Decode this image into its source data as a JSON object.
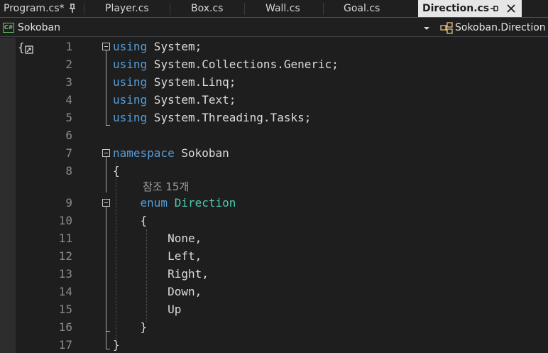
{
  "tabs": [
    {
      "label": "Program.cs*",
      "pinned": true,
      "active": false
    },
    {
      "label": "Player.cs",
      "active": false
    },
    {
      "label": "Box.cs",
      "active": false
    },
    {
      "label": "Wall.cs",
      "active": false
    },
    {
      "label": "Goal.cs",
      "active": false
    },
    {
      "label": "Direction.cs",
      "pinned": true,
      "active": true
    }
  ],
  "navbar": {
    "project_badge": "C#",
    "project": "Sokoban",
    "member": "Sokoban.Direction"
  },
  "editor": {
    "language": "csharp",
    "lines": [
      {
        "n": "1",
        "tokens": [
          [
            "kw",
            "using"
          ],
          [
            "pl",
            " System;"
          ]
        ]
      },
      {
        "n": "2",
        "tokens": [
          [
            "kw",
            "using"
          ],
          [
            "pl",
            " System.Collections.Generic;"
          ]
        ]
      },
      {
        "n": "3",
        "tokens": [
          [
            "kw",
            "using"
          ],
          [
            "pl",
            " System.Linq;"
          ]
        ]
      },
      {
        "n": "4",
        "tokens": [
          [
            "kw",
            "using"
          ],
          [
            "pl",
            " System.Text;"
          ]
        ]
      },
      {
        "n": "5",
        "tokens": [
          [
            "kw",
            "using"
          ],
          [
            "pl",
            " System.Threading.Tasks;"
          ]
        ]
      },
      {
        "n": "6",
        "tokens": []
      },
      {
        "n": "7",
        "tokens": [
          [
            "kw",
            "namespace"
          ],
          [
            "pl",
            " Sokoban"
          ]
        ]
      },
      {
        "n": "8",
        "tokens": [
          [
            "pl",
            "{"
          ]
        ]
      },
      {
        "n": "9",
        "tokens": [
          [
            "pl",
            "    "
          ],
          [
            "kw",
            "enum"
          ],
          [
            "pl",
            " "
          ],
          [
            "ty",
            "Direction"
          ]
        ]
      },
      {
        "n": "10",
        "tokens": [
          [
            "pl",
            "    {"
          ]
        ]
      },
      {
        "n": "11",
        "tokens": [
          [
            "pl",
            "        None,"
          ]
        ]
      },
      {
        "n": "12",
        "tokens": [
          [
            "pl",
            "        Left,"
          ]
        ]
      },
      {
        "n": "13",
        "tokens": [
          [
            "pl",
            "        Right,"
          ]
        ]
      },
      {
        "n": "14",
        "tokens": [
          [
            "pl",
            "        Down,"
          ]
        ]
      },
      {
        "n": "15",
        "tokens": [
          [
            "pl",
            "        Up"
          ]
        ]
      },
      {
        "n": "16",
        "tokens": [
          [
            "pl",
            "    }"
          ]
        ]
      },
      {
        "n": "17",
        "tokens": [
          [
            "pl",
            "}"
          ]
        ]
      }
    ],
    "codelens_text": "참조 15개"
  },
  "colors": {
    "keyword": "#569cd6",
    "type": "#4ec9b0",
    "plain": "#dcdcdc",
    "line_number": "#8a8a8a",
    "active_tab_bg": "#e6e6e6"
  }
}
